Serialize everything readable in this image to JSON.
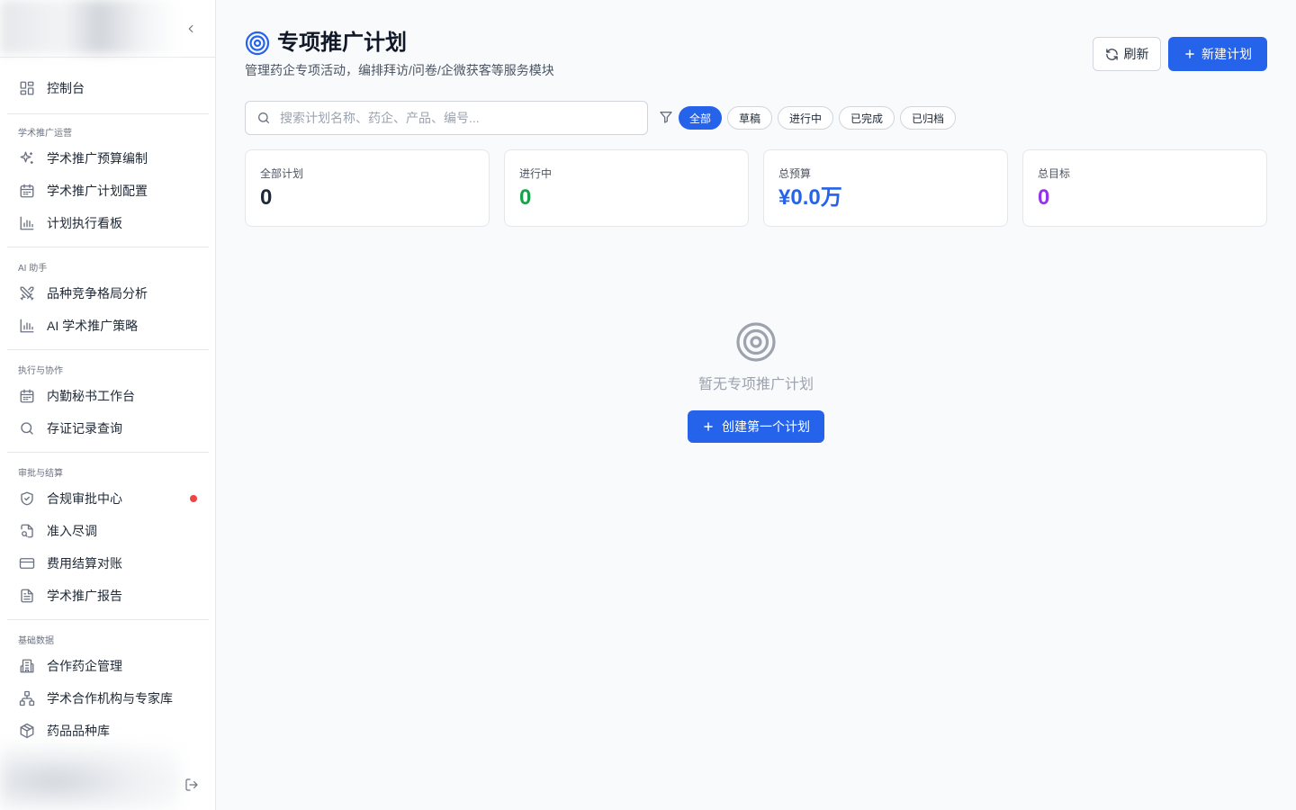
{
  "sidebar": {
    "top_item": {
      "label": "控制台",
      "icon": "dashboard-icon"
    },
    "sections": [
      {
        "title": "学术推广运营",
        "items": [
          {
            "label": "学术推广预算编制",
            "icon": "sparkles-icon"
          },
          {
            "label": "学术推广计划配置",
            "icon": "calendar-icon"
          },
          {
            "label": "计划执行看板",
            "icon": "bar-chart-icon"
          }
        ]
      },
      {
        "title": "AI 助手",
        "items": [
          {
            "label": "品种竞争格局分析",
            "icon": "swords-icon"
          },
          {
            "label": "AI 学术推广策略",
            "icon": "bar-chart-icon"
          }
        ]
      },
      {
        "title": "执行与协作",
        "items": [
          {
            "label": "内勤秘书工作台",
            "icon": "calendar-icon"
          },
          {
            "label": "存证记录查询",
            "icon": "search-icon"
          }
        ]
      },
      {
        "title": "审批与结算",
        "items": [
          {
            "label": "合规审批中心",
            "icon": "shield-check-icon",
            "has_notification_dot": true
          },
          {
            "label": "准入尽调",
            "icon": "file-search-icon"
          },
          {
            "label": "费用结算对账",
            "icon": "credit-card-icon"
          },
          {
            "label": "学术推广报告",
            "icon": "file-text-icon"
          }
        ]
      },
      {
        "title": "基础数据",
        "items": [
          {
            "label": "合作药企管理",
            "icon": "building-icon"
          },
          {
            "label": "学术合作机构与专家库",
            "icon": "network-icon"
          },
          {
            "label": "药品品种库",
            "icon": "package-icon"
          }
        ]
      }
    ]
  },
  "header": {
    "icon": "target-icon",
    "title": "专项推广计划",
    "subtitle": "管理药企专项活动，编排拜访/问卷/企微获客等服务模块",
    "refresh_label": "刷新",
    "new_label": "新建计划"
  },
  "search": {
    "placeholder": "搜索计划名称、药企、产品、编号...",
    "value": ""
  },
  "filters": {
    "chips": [
      "全部",
      "草稿",
      "进行中",
      "已完成",
      "已归档"
    ],
    "active": "全部"
  },
  "stats": [
    {
      "label": "全部计划",
      "value": "0",
      "color": "#1f2937"
    },
    {
      "label": "进行中",
      "value": "0",
      "color": "#16a34a"
    },
    {
      "label": "总预算",
      "value": "¥0.0万",
      "color": "#2563eb"
    },
    {
      "label": "总目标",
      "value": "0",
      "color": "#9333ea"
    }
  ],
  "empty_state": {
    "icon": "target-icon",
    "text": "暂无专项推广计划",
    "button_label": "创建第一个计划"
  },
  "colors": {
    "primary": "#2563eb",
    "notification": "#ef4444"
  }
}
